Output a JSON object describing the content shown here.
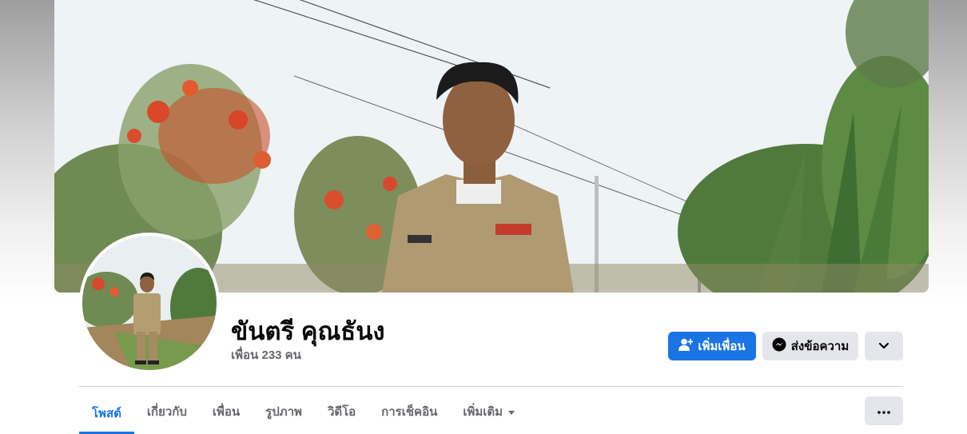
{
  "profile": {
    "name": "ขันตรี คุณธันง",
    "friends_text": "เพื่อน 233 คน"
  },
  "actions": {
    "add_friend_label": "เพิ่มเพื่อน",
    "add_friend_icon": "add-friend-icon",
    "message_label": "ส่งข้อความ",
    "message_icon": "messenger-icon",
    "more_icon": "chevron-down-icon"
  },
  "tabs": [
    {
      "label": "โพสต์",
      "active": true
    },
    {
      "label": "เกี่ยวกับ",
      "active": false
    },
    {
      "label": "เพื่อน",
      "active": false
    },
    {
      "label": "รูปภาพ",
      "active": false
    },
    {
      "label": "วิดีโอ",
      "active": false
    },
    {
      "label": "การเช็คอิน",
      "active": false
    },
    {
      "label": "เพิ่มเติม",
      "active": false
    }
  ],
  "tab_more_icon": "more-dots-icon",
  "colors": {
    "accent": "#1b74e4",
    "secondary_button": "#e4e6eb",
    "muted_text": "#65676b"
  }
}
